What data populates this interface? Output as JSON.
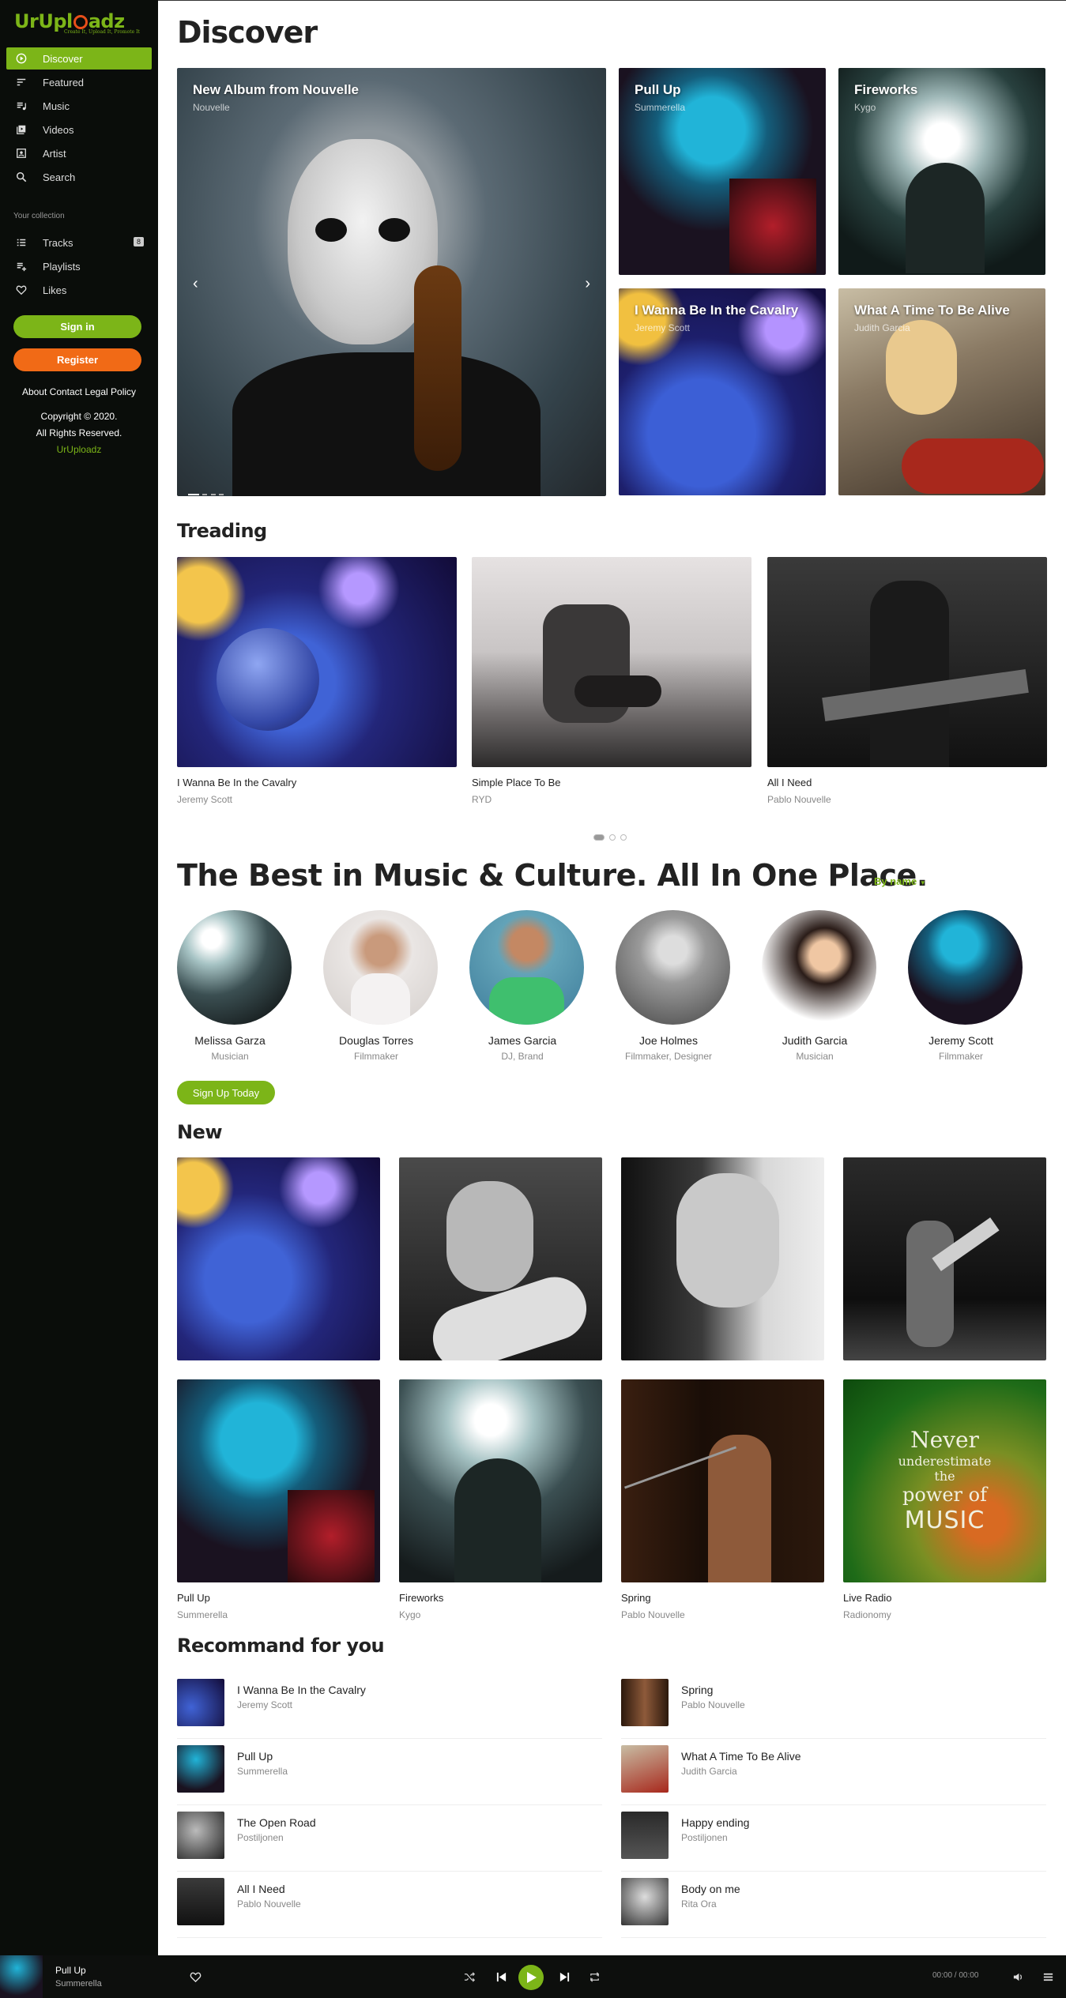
{
  "brand": {
    "name_a": "UrUpl",
    "name_b": "adz",
    "tagline": "Create It, Upload It, Promote It"
  },
  "sidebar": {
    "nav": [
      {
        "label": "Discover",
        "icon": "play-circle-icon"
      },
      {
        "label": "Featured",
        "icon": "sort-icon"
      },
      {
        "label": "Music",
        "icon": "playlist-icon"
      },
      {
        "label": "Videos",
        "icon": "video-library-icon"
      },
      {
        "label": "Artist",
        "icon": "contact-icon"
      },
      {
        "label": "Search",
        "icon": "search-icon"
      }
    ],
    "collection_label": "Your collection",
    "collection": [
      {
        "label": "Tracks",
        "icon": "list-icon",
        "count": "8"
      },
      {
        "label": "Playlists",
        "icon": "playlist-add-icon"
      },
      {
        "label": "Likes",
        "icon": "heart-icon"
      }
    ],
    "signin": "Sign in",
    "register": "Register",
    "links": "About Contact Legal Policy",
    "copyright1": "Copyright © 2020.",
    "copyright2": "All Rights Reserved.",
    "brandlink": "UrUploadz"
  },
  "main": {
    "title": "Discover",
    "hero": {
      "title": "New Album from Nouvelle",
      "sub": "Nouvelle",
      "prev": "‹",
      "next": "›"
    },
    "featured": [
      {
        "title": "Pull Up",
        "sub": "Summerella"
      },
      {
        "title": "Fireworks",
        "sub": "Kygo"
      },
      {
        "title": "I Wanna Be In the Cavalry",
        "sub": "Jeremy Scott"
      },
      {
        "title": "What A Time To Be Alive",
        "sub": "Judith Garcia"
      }
    ],
    "trending_title": "Treading",
    "trending": [
      {
        "title": "I Wanna Be In the Cavalry",
        "sub": "Jeremy Scott"
      },
      {
        "title": "Simple Place To Be",
        "sub": "RYD"
      },
      {
        "title": "All I Need",
        "sub": "Pablo Nouvelle"
      }
    ],
    "best_title": "The Best in Music & Culture. All In One Place.",
    "sort_label": "By name",
    "people": [
      {
        "name": "Melissa Garza",
        "role": "Musician"
      },
      {
        "name": "Douglas Torres",
        "role": "Filmmaker"
      },
      {
        "name": "James Garcia",
        "role": "DJ, Brand"
      },
      {
        "name": "Joe Holmes",
        "role": "Filmmaker, Designer"
      },
      {
        "name": "Judith Garcia",
        "role": "Musician"
      },
      {
        "name": "Jeremy Scott",
        "role": "Filmmaker"
      }
    ],
    "signup": "Sign Up Today",
    "new_title": "New",
    "new_bottom": [
      {
        "title": "Pull Up",
        "sub": "Summerella"
      },
      {
        "title": "Fireworks",
        "sub": "Kygo"
      },
      {
        "title": "Spring",
        "sub": "Pablo Nouvelle"
      },
      {
        "title": "Live Radio",
        "sub": "Radionomy"
      }
    ],
    "poster": {
      "l1": "Never",
      "l2": "underestimate",
      "l3": "the",
      "l4": "power of",
      "l5": "MUSIC"
    },
    "rec_title": "Recommand for you",
    "rec": [
      {
        "title": "I Wanna Be In the Cavalry",
        "sub": "Jeremy Scott"
      },
      {
        "title": "Spring",
        "sub": "Pablo Nouvelle"
      },
      {
        "title": "Pull Up",
        "sub": "Summerella"
      },
      {
        "title": "What A Time To Be Alive",
        "sub": "Judith Garcia"
      },
      {
        "title": "The Open Road",
        "sub": "Postiljonen"
      },
      {
        "title": "Happy ending",
        "sub": "Postiljonen"
      },
      {
        "title": "All I Need",
        "sub": "Pablo Nouvelle"
      },
      {
        "title": "Body on me",
        "sub": "Rita Ora"
      }
    ]
  },
  "player": {
    "title": "Pull Up",
    "sub": "Summerella",
    "time": "00:00 / 00:00"
  },
  "colors": {
    "accent": "#7cb518",
    "orange": "#f16a16",
    "sidebar": "#0a0d0a"
  }
}
